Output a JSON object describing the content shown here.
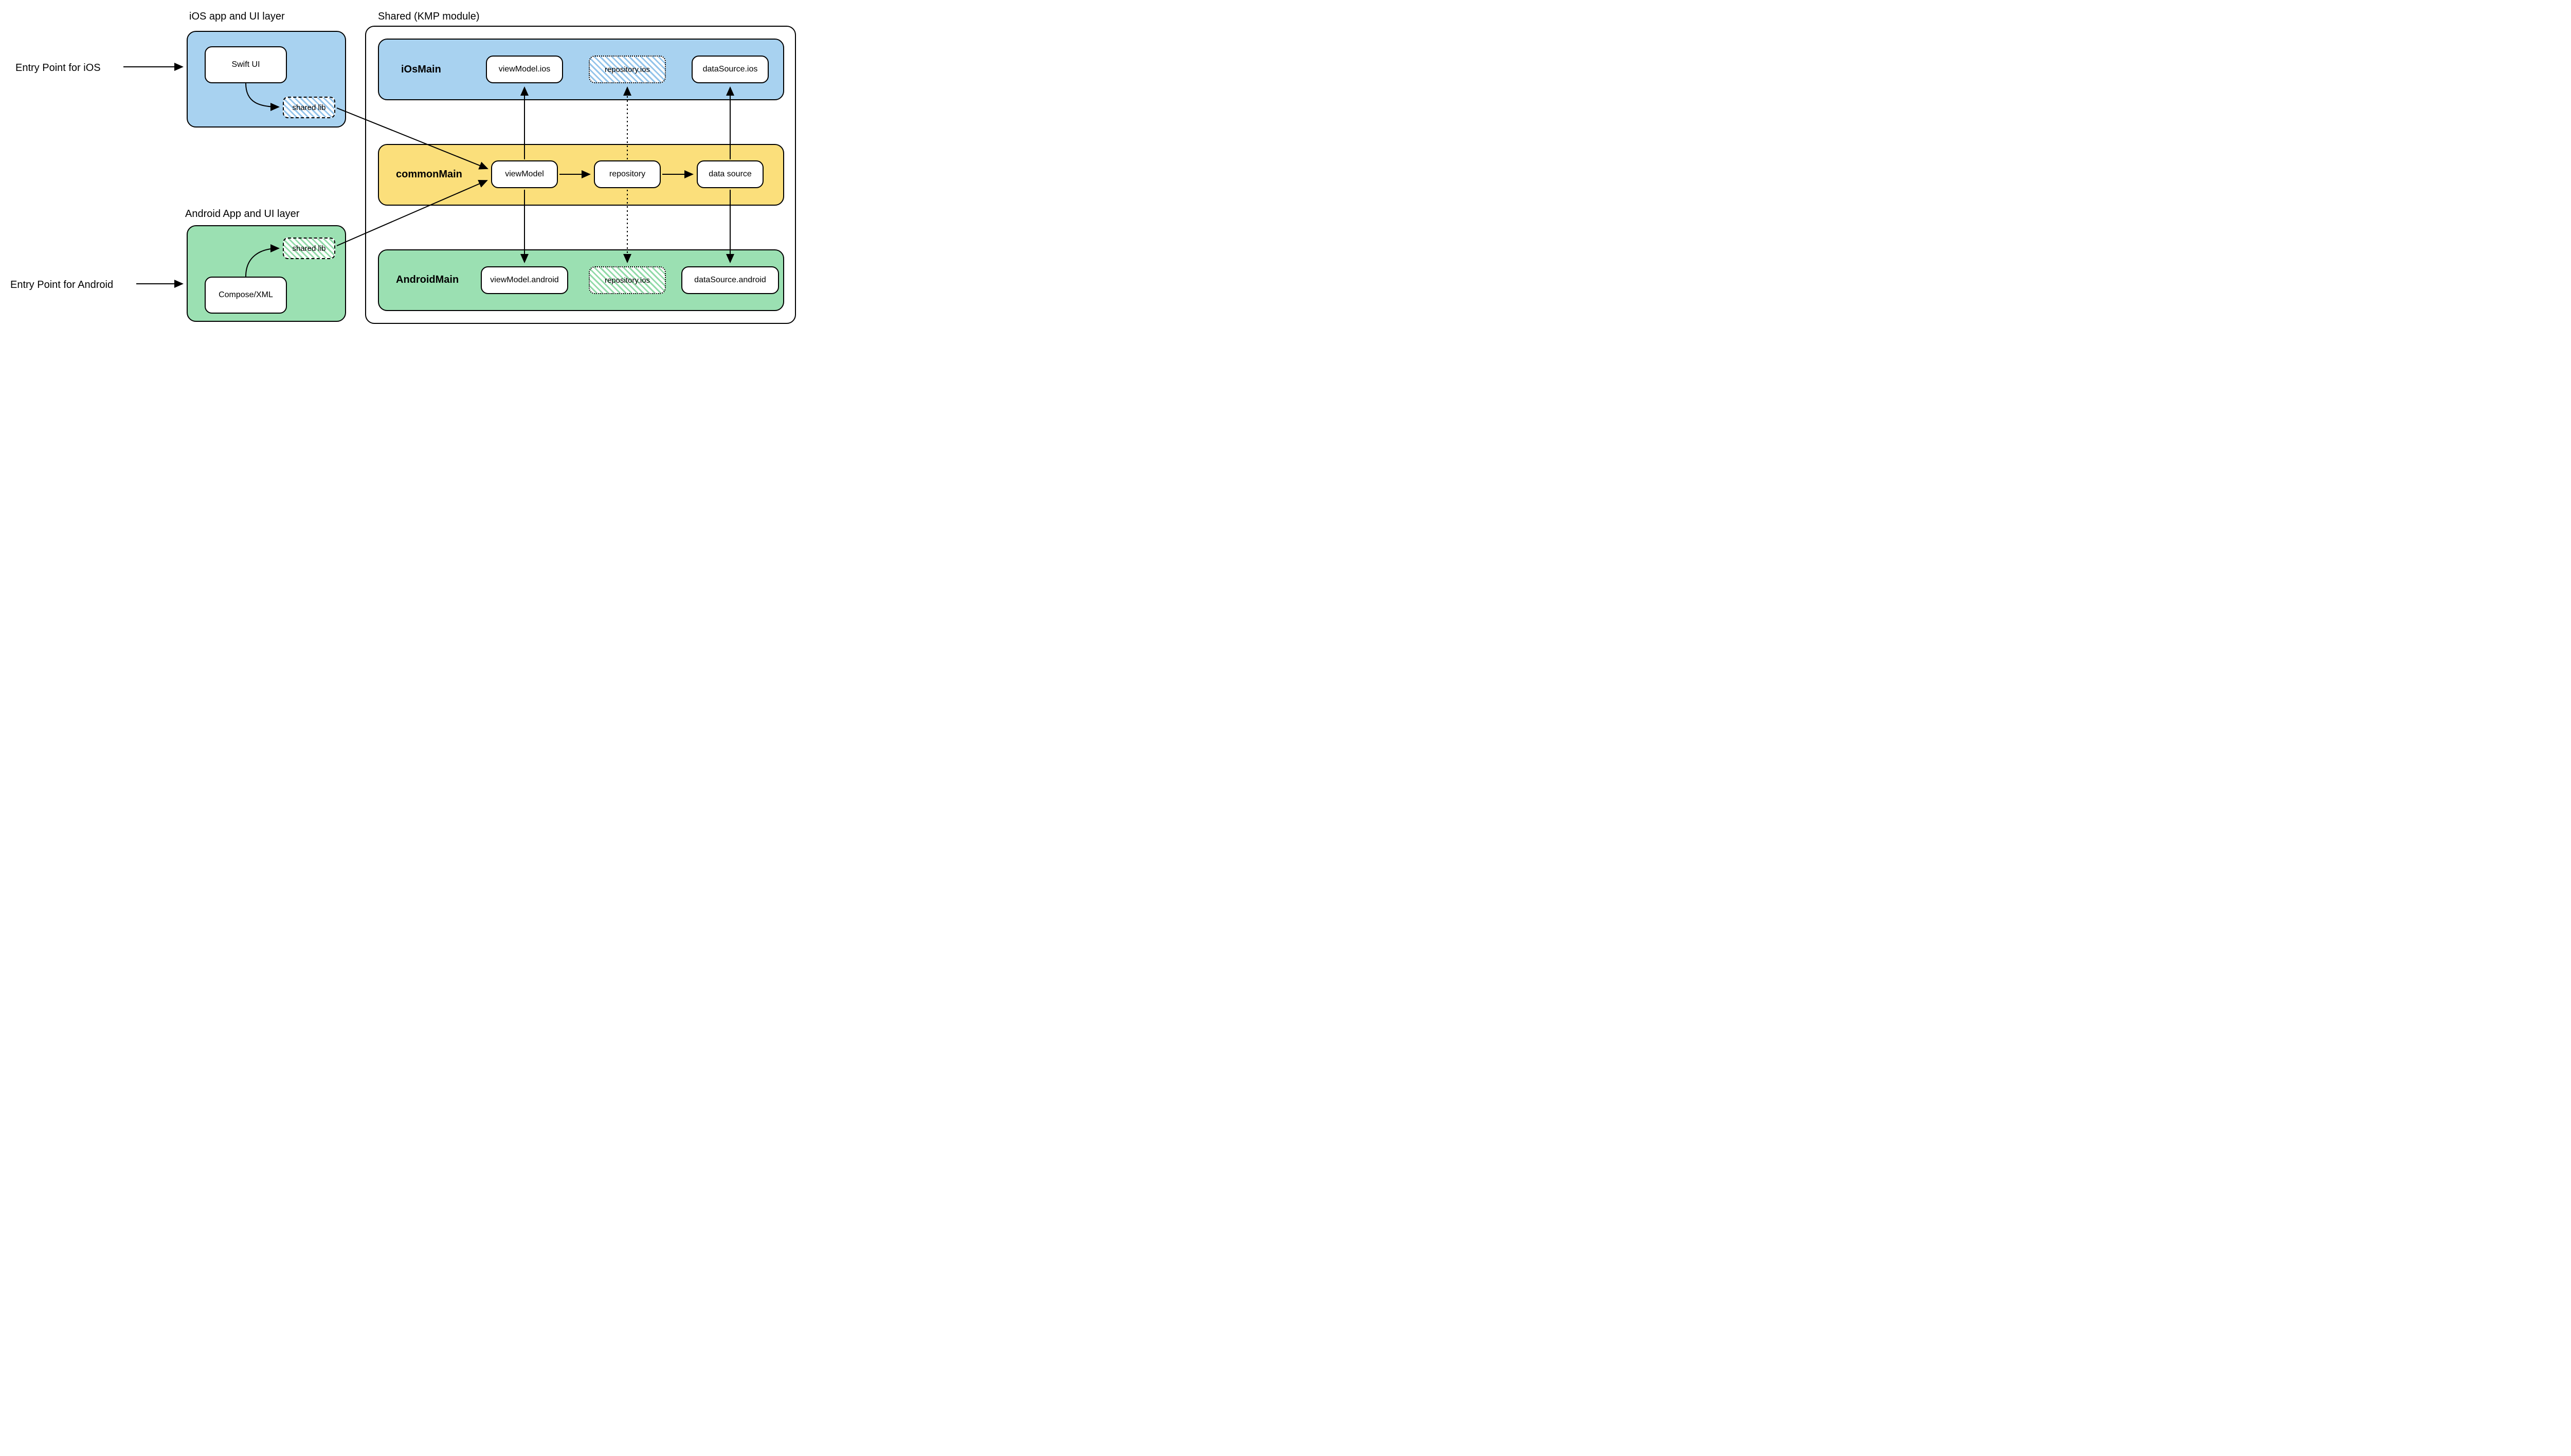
{
  "titles": {
    "ios_layer": "iOS app and UI layer",
    "shared_module": "Shared (KMP module)",
    "android_layer": "Android App and UI layer"
  },
  "entry_points": {
    "ios": "Entry Point for iOS",
    "android": "Entry Point for Android"
  },
  "ios_app": {
    "swift_ui": "Swift UI",
    "shared_lib": "shared lib"
  },
  "android_app": {
    "compose": "Compose/XML",
    "shared_lib": "shared lib"
  },
  "shared": {
    "ios_main": {
      "title": "iOsMain",
      "viewmodel": "viewModel.ios",
      "repository": "repository.ios",
      "datasource": "dataSource.ios"
    },
    "common_main": {
      "title": "commonMain",
      "viewmodel": "viewModel",
      "repository": "repository",
      "datasource": "data source"
    },
    "android_main": {
      "title": "AndroidMain",
      "viewmodel": "viewModel.android",
      "repository": "repository.ios",
      "datasource": "dataSource.android"
    }
  },
  "colors": {
    "blue": "#a8d2f0",
    "yellow": "#fbdf7b",
    "green": "#9be0b2"
  }
}
